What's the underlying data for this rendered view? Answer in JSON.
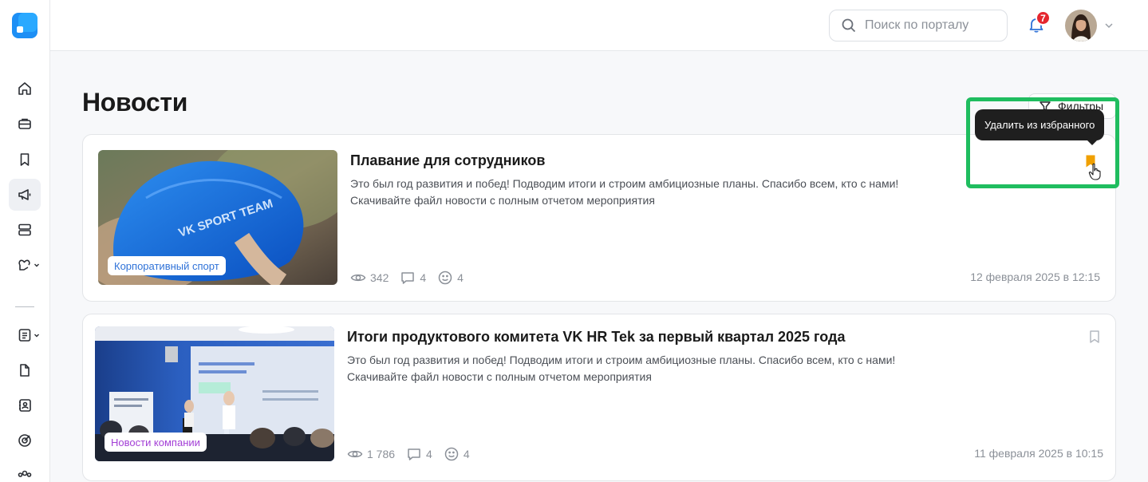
{
  "header": {
    "search_placeholder": "Поиск по порталу",
    "notifications_count": "7"
  },
  "page": {
    "title": "Новости",
    "filters_label": "Фильтры"
  },
  "tooltip": "Удалить из избранного",
  "colors": {
    "accent_blue": "#2f72d8",
    "bookmark_active": "#f0a000",
    "highlight": "#1fbd5f",
    "badge": "#e5262e"
  },
  "news": [
    {
      "title": "Плавание для сотрудников",
      "description": "Это был год развития и побед!  Подводим итоги и строим амбициозные планы. Спасибо всем, кто с нами! Скачивайте файл новости с полным отчетом мероприятия",
      "tag": "Корпоративный спорт",
      "views": "342",
      "comments": "4",
      "reactions": "4",
      "date": "12 февраля 2025 в 12:15",
      "bookmarked": true,
      "image_text": "VK SPORT TEAM"
    },
    {
      "title": "Итоги продуктового комитета VK HR Tek за первый квартал 2025 года",
      "description": "Это был год развития и побед!  Подводим итоги и строим амбициозные планы. Спасибо всем, кто с нами! Скачивайте файл новости с полным отчетом мероприятия",
      "tag": "Новости компании",
      "views": "1 786",
      "comments": "4",
      "reactions": "4",
      "date": "11 февраля 2025 в 10:15",
      "bookmarked": false
    }
  ]
}
